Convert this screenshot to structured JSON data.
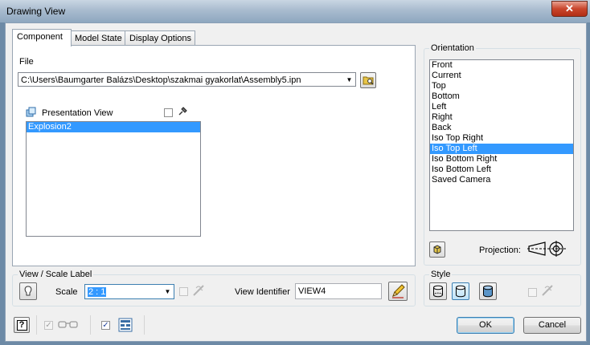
{
  "window": {
    "title": "Drawing View",
    "close_glyph": "✕"
  },
  "tabs": [
    {
      "label": "Component"
    },
    {
      "label": "Model State"
    },
    {
      "label": "Display Options"
    }
  ],
  "component": {
    "file_label": "File",
    "file_path": "C:\\Users\\Baumgarter Balázs\\Desktop\\szakmai gyakorlat\\Assembly5.ipn",
    "presentation_view_label": "Presentation View",
    "presentation_items": [
      "Explosion2"
    ],
    "presentation_selected": 0
  },
  "orientation": {
    "title": "Orientation",
    "items": [
      "Front",
      "Current",
      "Top",
      "Bottom",
      "Left",
      "Right",
      "Back",
      "Iso Top Right",
      "Iso Top Left",
      "Iso Bottom Right",
      "Iso Bottom Left",
      "Saved Camera"
    ],
    "selected": "Iso Top Left",
    "projection_label": "Projection:"
  },
  "view_scale": {
    "title": "View / Scale Label",
    "scale_label": "Scale",
    "scale_value": "2 : 1",
    "view_identifier_label": "View Identifier",
    "view_identifier_value": "VIEW4"
  },
  "style": {
    "title": "Style"
  },
  "footer": {
    "ok_label": "OK",
    "cancel_label": "Cancel",
    "help_glyph": "?"
  },
  "colors": {
    "selection": "#3399ff",
    "titlebar": "#a9bccf",
    "close": "#c9462c"
  },
  "icons": [
    "presentation-view-icon",
    "browse-folder-icon",
    "pin-icon",
    "edit-label-icon",
    "help-icon",
    "glasses-icon",
    "layout-icon",
    "style-hidden-lines-icon",
    "style-hidden-removed-icon",
    "style-shaded-icon",
    "camera-icon",
    "first-angle-projection-icon"
  ]
}
